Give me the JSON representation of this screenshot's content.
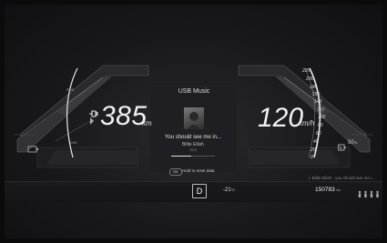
{
  "range": {
    "value": "385",
    "unit": "km"
  },
  "speed": {
    "value": "120",
    "unit": "km/h"
  },
  "media": {
    "source": "USB Music",
    "song": "You should see me in...",
    "artist": "Billie Eilish",
    "year": "2019",
    "progress_fraction": 0.45
  },
  "hint": {
    "button": "OK",
    "text": "Hold to reset data"
  },
  "speed_scale": [
    "220",
    "200",
    "180",
    "160",
    "140",
    "120",
    "100",
    "80",
    "60",
    "40",
    "20",
    "0"
  ],
  "left_gauge": {
    "top_label": "PWR",
    "mid_label": "CHG"
  },
  "status_bar": {
    "gear": "D",
    "temperature": "-21",
    "temperature_unit": "°C",
    "odometer": "150783",
    "odometer_unit": "km"
  },
  "battery": {
    "percent": "50",
    "unit": "%"
  },
  "right_media": {
    "text": "Billie Eilish - you should see me i..."
  },
  "colors": {
    "accent": "#f2f2f2",
    "background": "#141416"
  }
}
